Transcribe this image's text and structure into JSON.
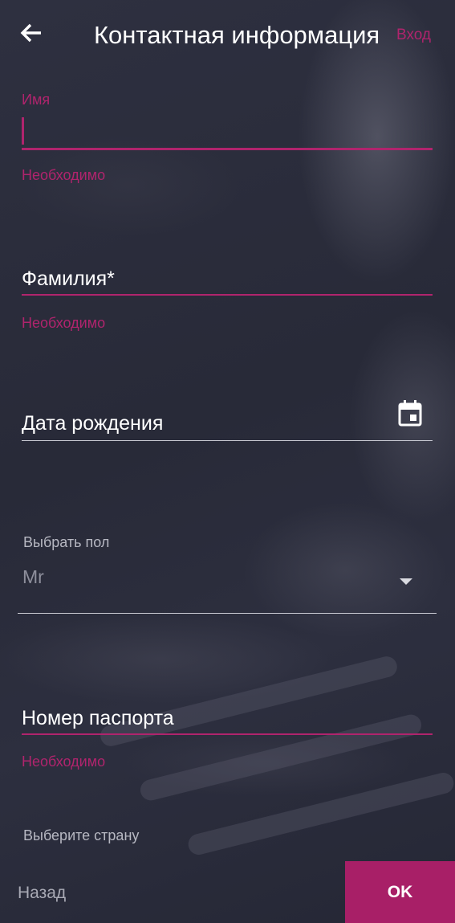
{
  "header": {
    "title": "Контактная информация",
    "login_label": "Вход"
  },
  "fields": {
    "first_name": {
      "label": "Имя",
      "error": "Необходимо"
    },
    "last_name": {
      "placeholder": "Фамилия*",
      "error": "Необходимо"
    },
    "birth_date": {
      "placeholder": "Дата рождения"
    },
    "gender": {
      "label": "Выбрать пол",
      "value": "Mr"
    },
    "passport": {
      "placeholder": "Номер паспорта",
      "error": "Необходимо"
    },
    "country": {
      "label": "Выберите страну"
    }
  },
  "footer": {
    "back_label": "Назад",
    "ok_label": "OK"
  },
  "colors": {
    "accent": "#b0246d",
    "ok_button": "#a81f67",
    "background": "#2b2d3d"
  },
  "icons": {
    "back": "arrow-left-icon",
    "calendar": "calendar-icon",
    "dropdown": "triangle-down-icon"
  }
}
